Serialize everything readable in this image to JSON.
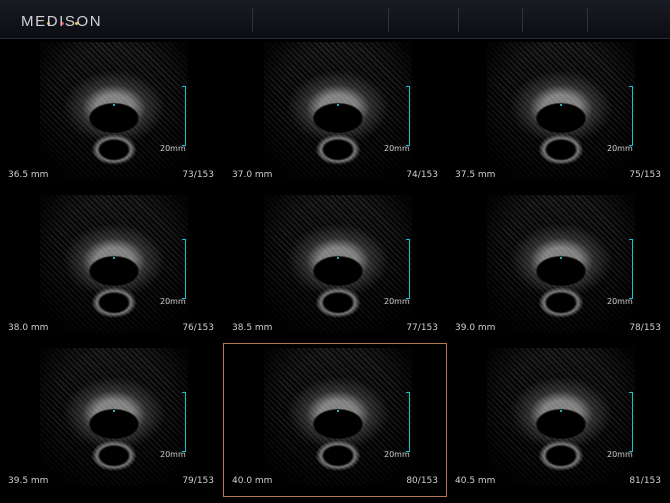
{
  "app": {
    "brand": "MEDISON",
    "logo_dots": [
      "#f2b233",
      "#e04646",
      "#e2c34a"
    ]
  },
  "tiles": [
    {
      "depth": "36.5 mm",
      "frame": "73/153",
      "scale": "20mm",
      "selected": false
    },
    {
      "depth": "37.0 mm",
      "frame": "74/153",
      "scale": "20mm",
      "selected": false
    },
    {
      "depth": "37.5 mm",
      "frame": "75/153",
      "scale": "20mm",
      "selected": false
    },
    {
      "depth": "38.0 mm",
      "frame": "76/153",
      "scale": "20mm",
      "selected": false
    },
    {
      "depth": "38.5 mm",
      "frame": "77/153",
      "scale": "20mm",
      "selected": false
    },
    {
      "depth": "39.0 mm",
      "frame": "78/153",
      "scale": "20mm",
      "selected": false
    },
    {
      "depth": "39.5 mm",
      "frame": "79/153",
      "scale": "20mm",
      "selected": false
    },
    {
      "depth": "40.0 mm",
      "frame": "80/153",
      "scale": "20mm",
      "selected": true
    },
    {
      "depth": "40.5 mm",
      "frame": "81/153",
      "scale": "20mm",
      "selected": false
    }
  ]
}
